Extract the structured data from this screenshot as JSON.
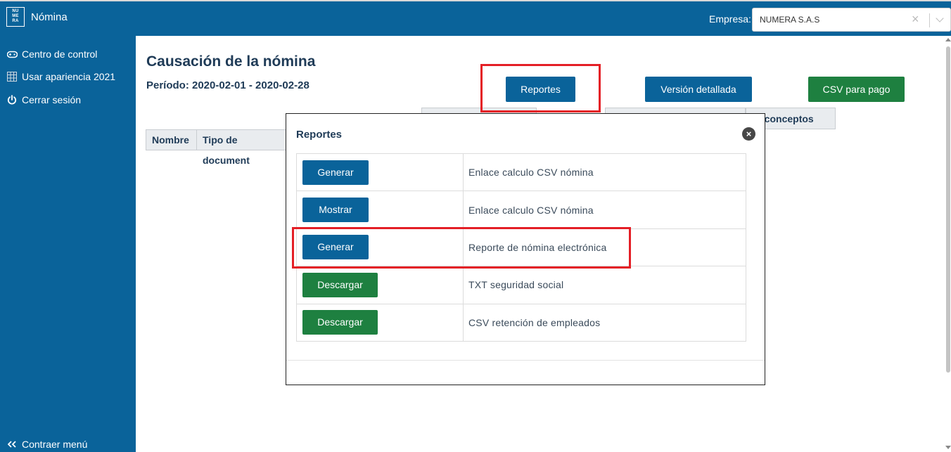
{
  "app": {
    "logo_text": "NU ME RA",
    "title": "Nómina"
  },
  "header": {
    "empresa_label": "Empresa:",
    "empresa_value": "NUMERA S.A.S",
    "clear_glyph": "×"
  },
  "sidebar": {
    "items": [
      {
        "label": "Centro de control",
        "icon": "gamepad-icon"
      },
      {
        "label": "Usar apariencia 2021",
        "icon": "grid-calendar-icon"
      },
      {
        "label": "Cerrar sesión",
        "icon": "power-icon"
      }
    ],
    "collapse": {
      "label": "Contraer menú",
      "icon": "double-chevron-left-icon"
    }
  },
  "main": {
    "title": "Causación de la nómina",
    "period": "Período: 2020-02-01 - 2020-02-28",
    "buttons": {
      "reportes": "Reportes",
      "version": "Versión detallada",
      "csv": "CSV para pago"
    },
    "tabs_partial": [
      "",
      "",
      "ros conceptos"
    ],
    "table_headers": [
      "Nombre",
      "Tipo de document"
    ]
  },
  "modal": {
    "title": "Reportes",
    "close_glyph": "×",
    "rows": [
      {
        "button": "Generar",
        "button_color": "blue",
        "description": "Enlace calculo CSV nómina"
      },
      {
        "button": "Mostrar",
        "button_color": "blue",
        "description": "Enlace calculo CSV nómina"
      },
      {
        "button": "Generar",
        "button_color": "blue",
        "description": "Reporte de nómina electrónica"
      },
      {
        "button": "Descargar",
        "button_color": "green",
        "description": "TXT seguridad social"
      },
      {
        "button": "Descargar",
        "button_color": "green",
        "description": "CSV retención de empleados"
      }
    ]
  },
  "colors": {
    "primary": "#0a639a",
    "success": "#1e8040",
    "highlight": "#e41f26",
    "text_dark": "#1f3b57"
  }
}
